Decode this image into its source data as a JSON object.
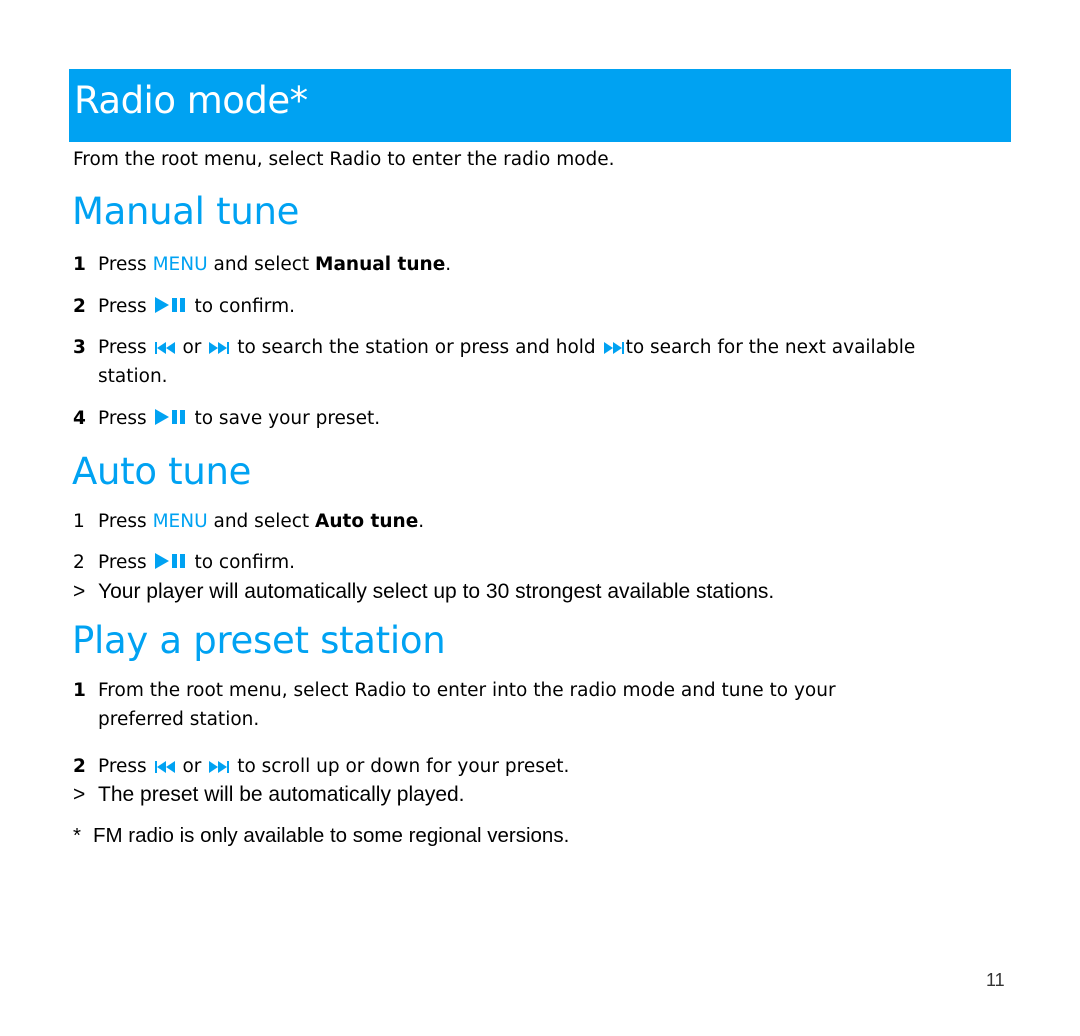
{
  "accent_color": "#00a2f2",
  "header": {
    "title": "Radio mode*"
  },
  "intro": "From the root menu, select Radio to enter the radio mode.",
  "manual_tune": {
    "heading": "Manual tune",
    "steps": [
      {
        "num": "1",
        "pre": "Press ",
        "key": "MENU",
        "mid": " and select ",
        "bold": "Manual tune",
        "post": "."
      },
      {
        "num": "2",
        "pre": "Press",
        "icon": "play-pause-icon",
        "post": "to confirm."
      },
      {
        "num": "3",
        "pre": "Press",
        "icon1": "previous-icon",
        "or": "or",
        "icon2": "next-icon",
        "mid": "to search the station or press and hold",
        "icon3": "next-icon",
        "post": "to search for the next available",
        "cont": "station."
      },
      {
        "num": "4",
        "pre": "Press",
        "icon": "play-pause-icon",
        "post": "to save your preset."
      }
    ]
  },
  "auto_tune": {
    "heading": "Auto tune",
    "steps": [
      {
        "num": "1",
        "pre": "Press ",
        "key": "MENU",
        "mid": " and select ",
        "bold": "Auto tune",
        "post": "."
      },
      {
        "num": "2",
        "pre": "Press",
        "icon": "play-pause-icon",
        "post": "to confirm."
      }
    ],
    "result_symbol": ">",
    "result": "Your player will automatically select up to 30 strongest available stations."
  },
  "preset": {
    "heading": "Play a preset station",
    "steps": [
      {
        "num": "1",
        "text": "From the root menu, select Radio to enter into the radio mode and tune to your",
        "cont": "preferred station."
      },
      {
        "num": "2",
        "pre": "Press",
        "icon1": "previous-icon",
        "or": "or",
        "icon2": "next-icon",
        "post": "to scroll up or down for your preset."
      }
    ],
    "result_symbol": ">",
    "result": "The preset will be automatically played."
  },
  "footnote": {
    "symbol": "*",
    "text": "FM radio is only available to some regional versions."
  },
  "page_number": "11"
}
